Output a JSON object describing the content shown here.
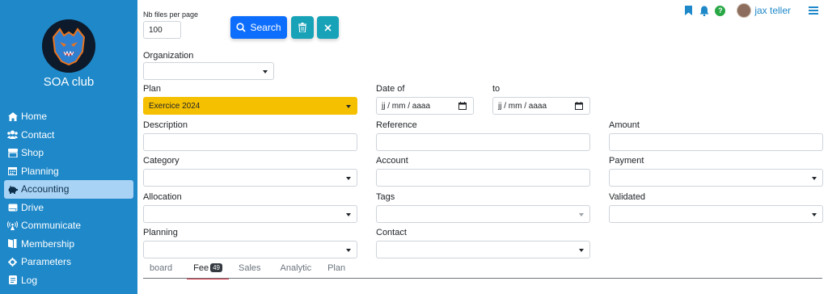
{
  "sidebar": {
    "club_name": "SOA club",
    "items": [
      {
        "label": "Home",
        "icon": "home-icon"
      },
      {
        "label": "Contact",
        "icon": "users-icon"
      },
      {
        "label": "Shop",
        "icon": "shop-icon"
      },
      {
        "label": "Planning",
        "icon": "calendar-icon"
      },
      {
        "label": "Accounting",
        "icon": "piggy-bank-icon"
      },
      {
        "label": "Drive",
        "icon": "drive-icon"
      },
      {
        "label": "Communicate",
        "icon": "broadcast-icon"
      },
      {
        "label": "Membership",
        "icon": "id-card-icon"
      },
      {
        "label": "Parameters",
        "icon": "gear-icon"
      },
      {
        "label": "Log",
        "icon": "log-icon"
      }
    ],
    "active_index": 4
  },
  "topbar": {
    "help_label": "?",
    "username": "jax teller"
  },
  "toolbar": {
    "nb_files_label": "Nb files per page",
    "nb_files_value": "100",
    "search_label": "Search"
  },
  "form": {
    "organization_label": "Organization",
    "organization_value": "",
    "plan_label": "Plan",
    "plan_value": "Exercice 2024",
    "date_of_label": "Date of",
    "date_of_placeholder": "jj / mm / aaaa",
    "to_label": "to",
    "to_placeholder": "jj / mm / aaaa",
    "description_label": "Description",
    "description_value": "",
    "reference_label": "Reference",
    "reference_value": "",
    "amount_label": "Amount",
    "amount_value": "",
    "category_label": "Category",
    "account_label": "Account",
    "account_value": "",
    "payment_label": "Payment",
    "allocation_label": "Allocation",
    "tags_label": "Tags",
    "validated_label": "Validated",
    "planning_label": "Planning",
    "contact_label": "Contact"
  },
  "tabs": [
    {
      "label": "board"
    },
    {
      "label": "Fee",
      "badge": "49"
    },
    {
      "label": "Sales"
    },
    {
      "label": "Analytic"
    },
    {
      "label": "Plan"
    }
  ],
  "colors": {
    "sidebar": "#1e88c9",
    "active_item": "#a9d3f5",
    "plan_highlight": "#f5c000",
    "primary": "#0d6efd",
    "info": "#17a2b8",
    "active_tab_underline": "#dc3545"
  }
}
